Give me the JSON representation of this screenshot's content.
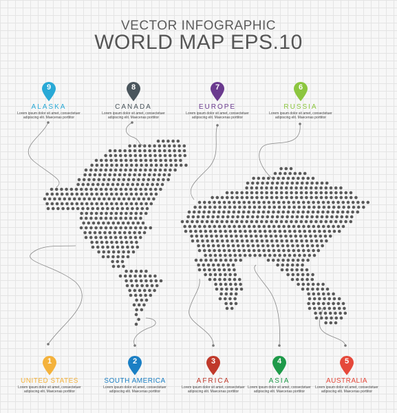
{
  "header": {
    "subtitle": "VECTOR INFOGRAPHIC",
    "title": "WORLD MAP EPS.10"
  },
  "description": {
    "line1": "Lorem ipsum dolor sit amet, consectetuer",
    "line2": "adipiscing elit. Maecenas porttitor"
  },
  "colors": {
    "dots": "#5a5a5a",
    "connector": "#888888"
  },
  "top_callouts": [
    {
      "number": "9",
      "label": "ALASKA",
      "color": "#29a9d6"
    },
    {
      "number": "8",
      "label": "CANADA",
      "color": "#4a555c"
    },
    {
      "number": "7",
      "label": "EUROPE",
      "color": "#6a3a8e"
    },
    {
      "number": "6",
      "label": "RUSSIA",
      "color": "#8cc63f"
    }
  ],
  "bottom_callouts": [
    {
      "number": "1",
      "label": "UNITED STATES",
      "color": "#f4b23c"
    },
    {
      "number": "2",
      "label": "SOUTH AMERICA",
      "color": "#1b7fc4"
    },
    {
      "number": "3",
      "label": "AFRICA",
      "color": "#c0392b"
    },
    {
      "number": "4",
      "label": "ASIA",
      "color": "#1e9a49"
    },
    {
      "number": "5",
      "label": "AUSTRALIA",
      "color": "#e5483a"
    }
  ]
}
